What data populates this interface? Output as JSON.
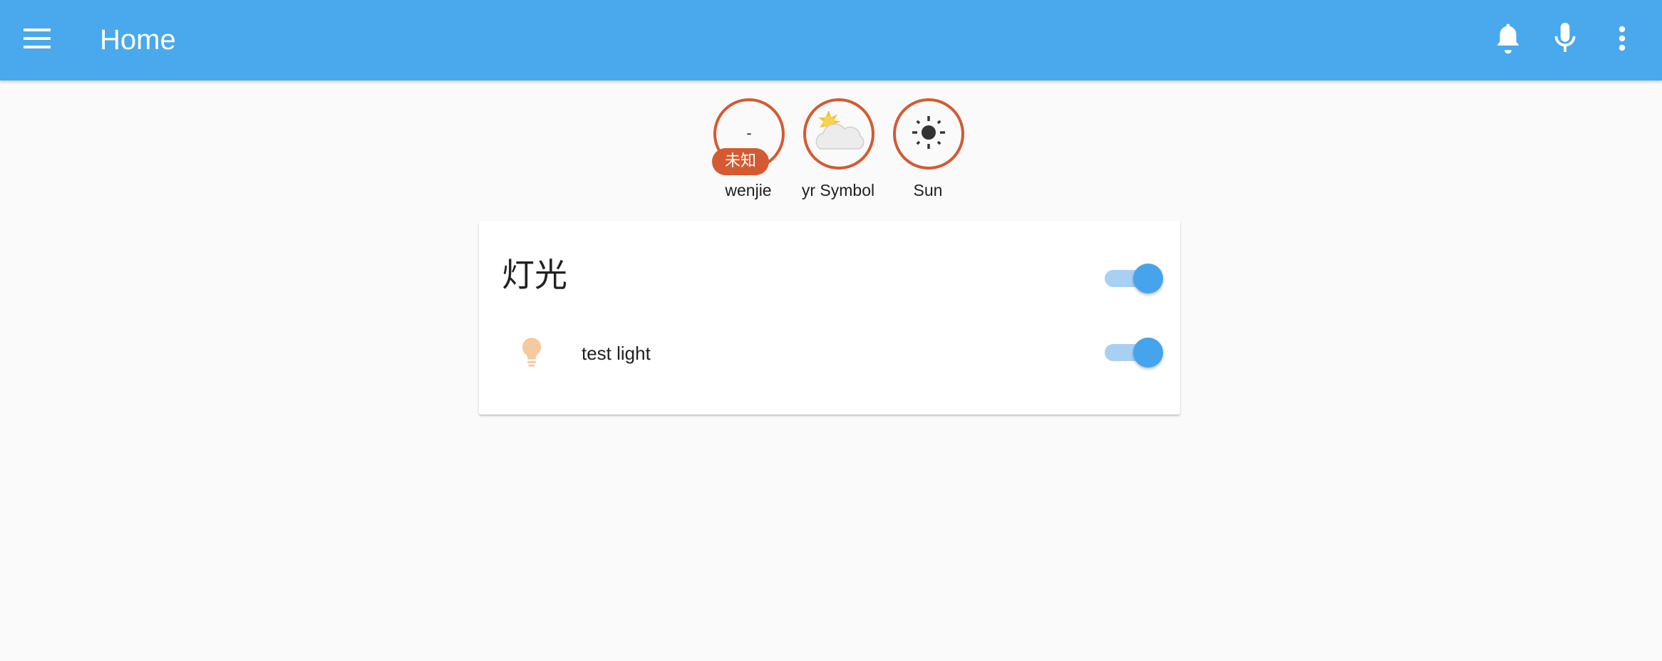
{
  "header": {
    "title": "Home",
    "menu_icon": "menu-icon",
    "actions": [
      "bell-icon",
      "microphone-icon",
      "more-vertical-icon"
    ],
    "background_color": "#4aa8ec"
  },
  "badges": [
    {
      "label": "wenjie",
      "value": "-",
      "tag": "未知",
      "icon": null
    },
    {
      "label": "yr Symbol",
      "value": "",
      "tag": "",
      "icon": "partly-cloudy-icon"
    },
    {
      "label": "Sun",
      "value": "",
      "tag": "",
      "icon": "sun-icon"
    }
  ],
  "card": {
    "title": "灯光",
    "group_toggle_on": true,
    "entities": [
      {
        "name": "test light",
        "icon": "lightbulb-icon",
        "state_on": true
      }
    ]
  },
  "colors": {
    "accent": "#45a4ec",
    "badge_border": "#d45a32",
    "bulb_on": "#f7c99e"
  }
}
